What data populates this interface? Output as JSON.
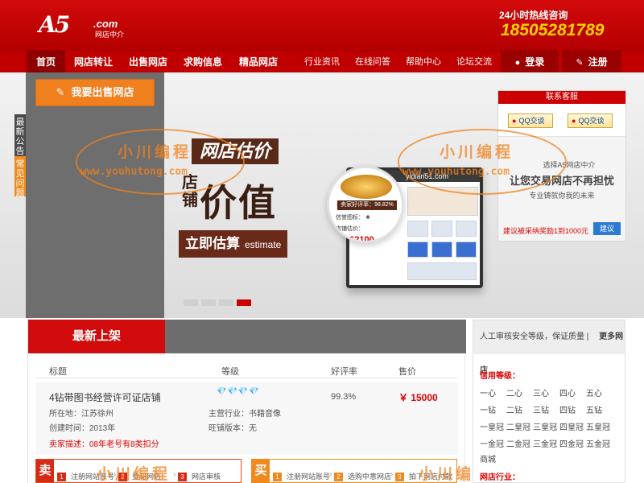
{
  "header": {
    "logo_text": "A5",
    "logo_com": ".com",
    "logo_sub": "网店中介",
    "hotline_label": "24小时热线咨询",
    "hotline_number": "18505281789"
  },
  "nav": {
    "main": [
      "首页",
      "网店转让",
      "出售网店",
      "求购信息",
      "精品网店"
    ],
    "secondary": [
      "行业资讯",
      "在线问答",
      "帮助中心",
      "论坛交流"
    ],
    "login": "登录",
    "register": "注册"
  },
  "banner": {
    "sell_button": "我要出售网店",
    "side_tab_notice": "最新公告",
    "side_tab_faq": "常见问题",
    "promo_title": "网店估价",
    "promo_subtitle_small": "店铺",
    "promo_subtitle_big": "价值",
    "promo_button": "立即估算",
    "promo_button_en": "estimate",
    "mock_url": "yidian51.com",
    "circle_rating": "卖家好评率：98.82%",
    "circle_icon_label": "信誉图标：",
    "circle_price_label": "店铺估价：",
    "circle_price": "￥462100",
    "slides_total": 4,
    "active_slide": 4
  },
  "cs_panel": {
    "title": "联系客服",
    "qq1": "QQ交谈",
    "qq2": "QQ交谈",
    "line1": "选择A5网店中介",
    "line2": "让您交易网店不再担忧",
    "line3": "专业铸就你我的未来",
    "tip": "建议被采纳奖励1到1000元",
    "suggest_button": "建议"
  },
  "watermark": {
    "text": "小川编程",
    "url": "www.youhutong.com"
  },
  "listing": {
    "title": "最新上架",
    "columns": [
      "标题",
      "等级",
      "好评率",
      "售价"
    ],
    "item": {
      "title": "4钻带图书经营许可证店铺",
      "level": "💎💎💎💎",
      "rating": "99.3%",
      "price": "￥ 15000",
      "location_label": "所在地：",
      "location": "江苏徐州",
      "created_label": "创建时间：",
      "created": "2013年",
      "industry_label": "主营行业：",
      "industry": "书籍音像",
      "wangpu_label": "旺铺版本：",
      "wangpu": "无",
      "description": "卖家描述：08年老号有8类扣分"
    }
  },
  "steps": {
    "sell_badge": "卖",
    "sell_steps": [
      "注册网站账号",
      "登记网店",
      "网店审核"
    ],
    "buy_badge": "买",
    "buy_steps": [
      "注册网站账号",
      "选购中意网店",
      "拍下网店付款"
    ]
  },
  "sidebar": {
    "head_text": "人工审核安全等级，保证质量",
    "more_link": "更多网店",
    "credit_label": "信用等级：",
    "levels": [
      [
        "一心",
        "二心",
        "三心",
        "四心",
        "五心"
      ],
      [
        "一钻",
        "二钻",
        "三钻",
        "四钻",
        "五钻"
      ],
      [
        "一皇冠",
        "二皇冠",
        "三皇冠",
        "四皇冠",
        "五皇冠"
      ],
      [
        "一金冠",
        "二金冠",
        "三金冠",
        "四金冠",
        "五金冠"
      ]
    ],
    "mall_label": "商城",
    "industry_label": "网店行业："
  },
  "colors": {
    "brand_red": "#c00000",
    "accent_orange": "#f07f1e",
    "hotline_yellow": "#ffd200"
  }
}
